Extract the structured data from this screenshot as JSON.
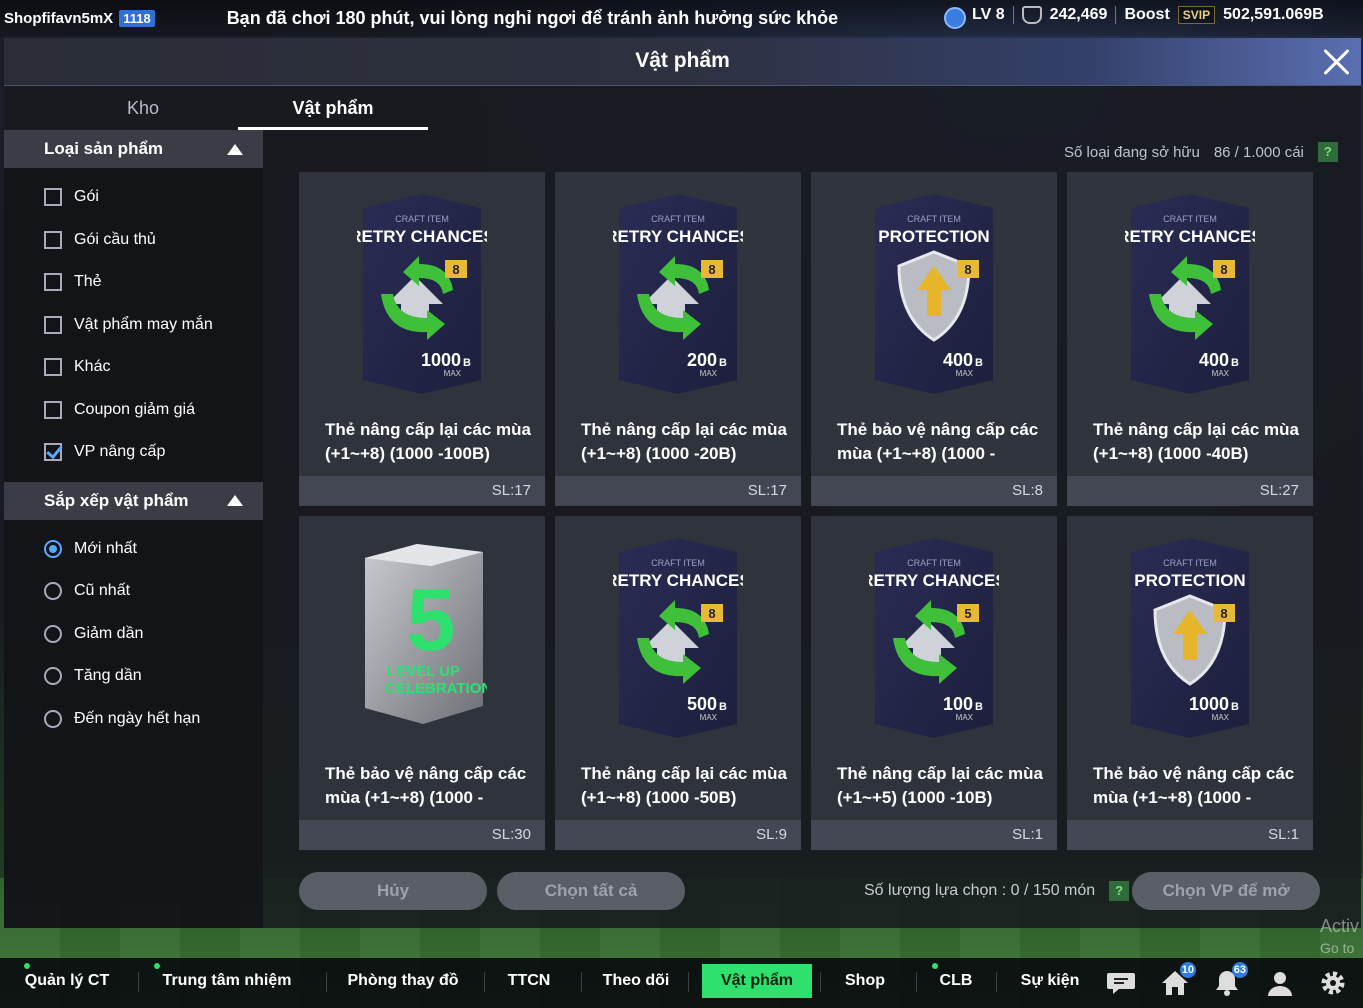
{
  "topbar": {
    "username": "Shopfifavn5mX",
    "level_badge": "1118",
    "notice": "Bạn đã chơi 180 phút, vui lòng nghỉ ngơi để tránh ảnh hưởng sức khỏe",
    "lv": "LV 8",
    "coins": "242,469",
    "boost_label": "Boost",
    "svip_label": "SVIP",
    "bp": "502,591.069B"
  },
  "modal": {
    "title": "Vật phẩm",
    "tabs": [
      {
        "label": "Kho",
        "active": false
      },
      {
        "label": "Vật phẩm",
        "active": true
      }
    ]
  },
  "sidebar": {
    "product_type": {
      "title": "Loại sản phẩm",
      "items": [
        {
          "label": "Gói",
          "checked": false
        },
        {
          "label": "Gói cầu thủ",
          "checked": false
        },
        {
          "label": "Thẻ",
          "checked": false
        },
        {
          "label": "Vật phẩm may mắn",
          "checked": false
        },
        {
          "label": "Khác",
          "checked": false
        },
        {
          "label": "Coupon giảm giá",
          "checked": false
        },
        {
          "label": "VP nâng cấp",
          "checked": true
        }
      ]
    },
    "sort": {
      "title": "Sắp xếp vật phẩm",
      "items": [
        {
          "label": "Mới nhất",
          "checked": true
        },
        {
          "label": "Cũ nhất",
          "checked": false
        },
        {
          "label": "Giảm dần",
          "checked": false
        },
        {
          "label": "Tăng dần",
          "checked": false
        },
        {
          "label": "Đến ngày hết hạn",
          "checked": false
        }
      ]
    }
  },
  "owned": {
    "label": "Số loại đang sở hữu",
    "value": "86 / 1.000 cái",
    "help": "?"
  },
  "cards": [
    {
      "kind": "retry",
      "craft": "CRAFT ITEM",
      "title": "RETRY CHANCES",
      "level": "8",
      "value": "1000",
      "unit": "B",
      "max": "MAX",
      "name": "Thẻ nâng cấp lại các mùa (+1~+8) (1000 -100B)",
      "qty": "SL:17"
    },
    {
      "kind": "retry",
      "craft": "CRAFT ITEM",
      "title": "RETRY CHANCES",
      "level": "8",
      "value": "200",
      "unit": "B",
      "max": "MAX",
      "name": "Thẻ nâng cấp lại các mùa (+1~+8) (1000 -20B)",
      "qty": "SL:17"
    },
    {
      "kind": "protect",
      "craft": "CRAFT ITEM",
      "title": "PROTECTION",
      "level": "8",
      "value": "400",
      "unit": "B",
      "max": "MAX",
      "name": "Thẻ bảo vệ nâng cấp các mùa (+1~+8) (1000 -",
      "qty": "SL:8"
    },
    {
      "kind": "retry",
      "craft": "CRAFT ITEM",
      "title": "RETRY CHANCES",
      "level": "8",
      "value": "400",
      "unit": "B",
      "max": "MAX",
      "name": "Thẻ nâng cấp lại các mùa (+1~+8) (1000 -40B)",
      "qty": "SL:27"
    },
    {
      "kind": "box",
      "box_number": "5",
      "box_text1": "LEVEL UP",
      "box_text2": "CELEBRATION",
      "name": "Thẻ bảo vệ nâng cấp các mùa (+1~+8) (1000 -",
      "qty": "SL:30"
    },
    {
      "kind": "retry",
      "craft": "CRAFT ITEM",
      "title": "RETRY CHANCES",
      "level": "8",
      "value": "500",
      "unit": "B",
      "max": "MAX",
      "name": "Thẻ nâng cấp lại các mùa (+1~+8) (1000 -50B)",
      "qty": "SL:9"
    },
    {
      "kind": "retry",
      "craft": "CRAFT ITEM",
      "title": "RETRY CHANCES",
      "level": "5",
      "value": "100",
      "unit": "B",
      "max": "MAX",
      "name": "Thẻ nâng cấp lại các mùa (+1~+5) (1000 -10B)",
      "qty": "SL:1"
    },
    {
      "kind": "protect",
      "craft": "CRAFT ITEM",
      "title": "PROTECTION",
      "level": "8",
      "value": "1000",
      "unit": "B",
      "max": "MAX",
      "name": "Thẻ bảo vệ nâng cấp các mùa (+1~+8) (1000 -",
      "qty": "SL:1"
    }
  ],
  "actions": {
    "cancel": "Hủy",
    "select_all": "Chọn tất cả",
    "selection_label": "Số lượng lựa chọn : 0 / 150 món",
    "help": "?",
    "open": "Chọn VP để mở"
  },
  "nav": {
    "items": [
      {
        "label": "Quản lý CT",
        "dot": true
      },
      {
        "label": "Trung tâm nhiệm vụ",
        "dot": true
      },
      {
        "label": "Phòng thay đồ",
        "dot": false
      },
      {
        "label": "TTCN",
        "dot": false
      },
      {
        "label": "Theo dõi",
        "dot": false
      },
      {
        "label": "Vật phẩm",
        "dot": false,
        "active": true
      },
      {
        "label": "Shop",
        "dot": false
      },
      {
        "label": "CLB",
        "dot": true
      },
      {
        "label": "Sự kiện",
        "dot": false
      }
    ],
    "home_badge": "10",
    "bell_badge": "63"
  },
  "watermark": {
    "line1": "Activ",
    "line2": "Go to"
  },
  "colors": {
    "accent_green": "#2ee06e",
    "checkbox_blue": "#5aa7ff",
    "card_bg": "#343842"
  }
}
